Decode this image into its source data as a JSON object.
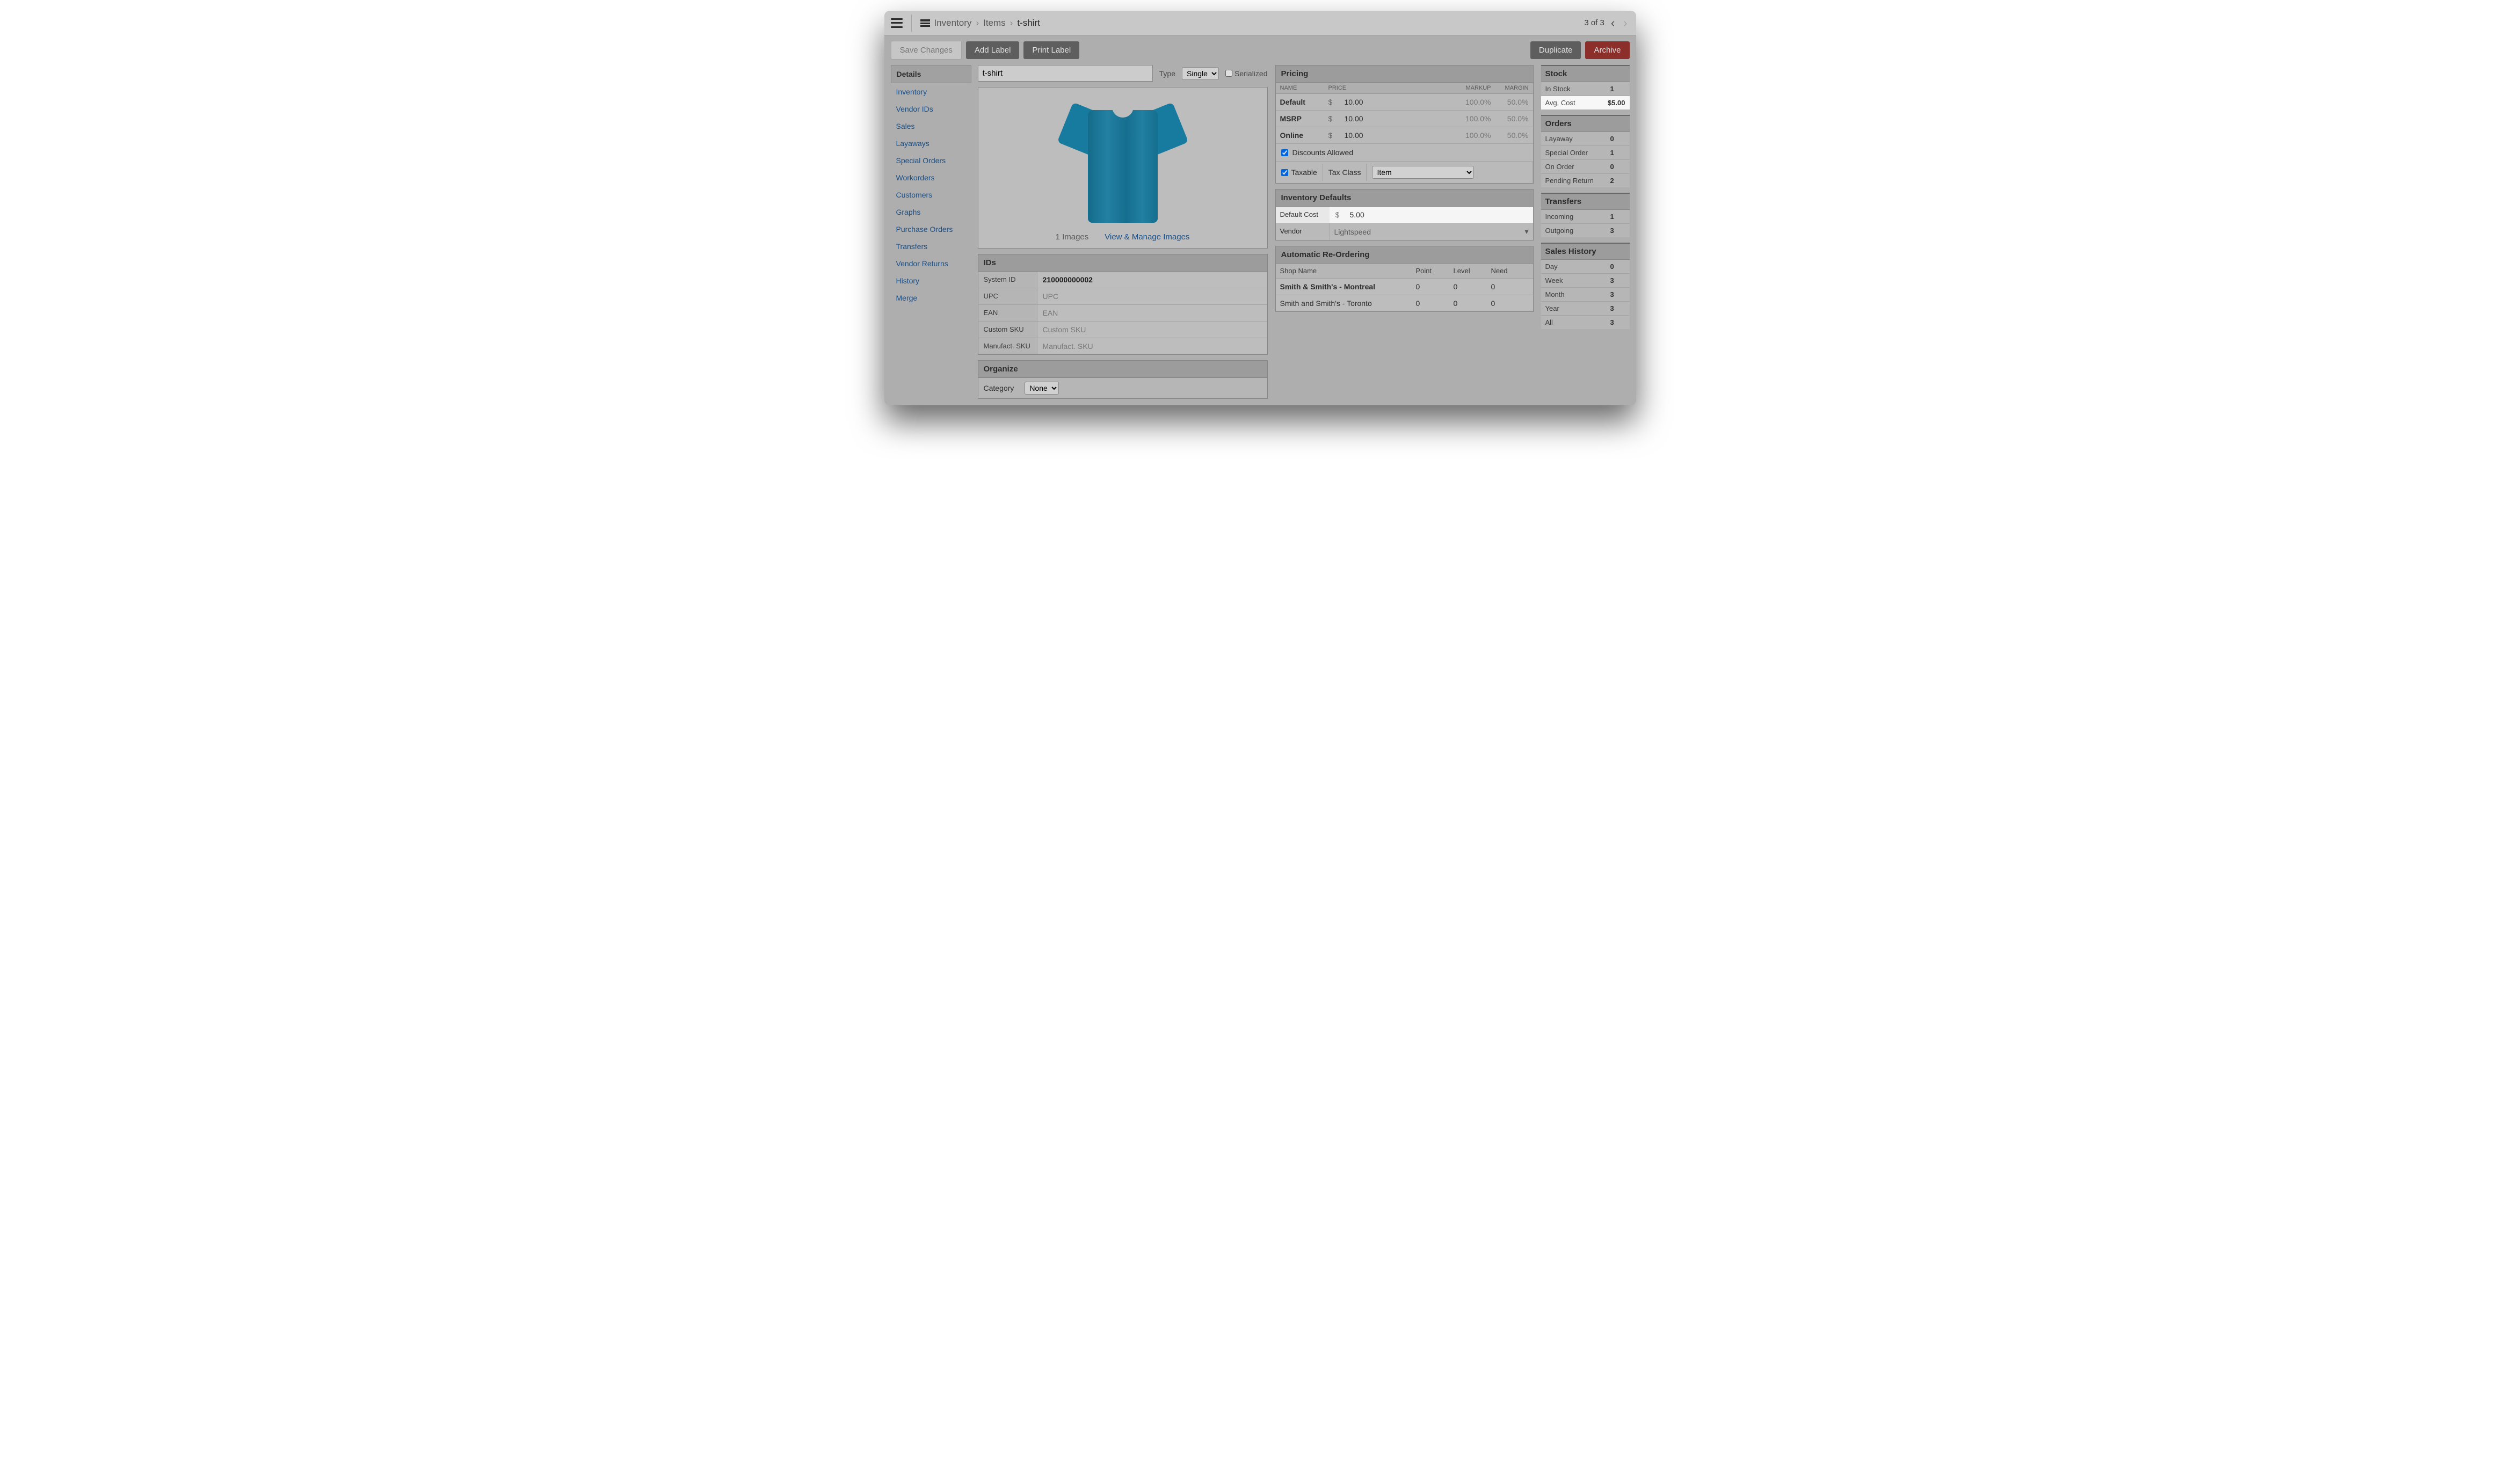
{
  "breadcrumb": {
    "root": "Inventory",
    "mid": "Items",
    "current": "t-shirt"
  },
  "pager": {
    "text": "3 of 3"
  },
  "toolbar": {
    "save": "Save Changes",
    "add_label": "Add Label",
    "print_label": "Print Label",
    "duplicate": "Duplicate",
    "archive": "Archive"
  },
  "sidebar": {
    "items": [
      "Details",
      "Inventory",
      "Vendor IDs",
      "Sales",
      "Layaways",
      "Special Orders",
      "Workorders",
      "Customers",
      "Graphs",
      "Purchase Orders",
      "Transfers",
      "Vendor Returns",
      "History",
      "Merge"
    ]
  },
  "item": {
    "name": "t-shirt",
    "type_label": "Type",
    "type_value": "Single",
    "serialized_label": "Serialized"
  },
  "images": {
    "count": "1 Images",
    "manage": "View & Manage Images"
  },
  "ids": {
    "title": "IDs",
    "rows": [
      {
        "label": "System ID",
        "value": "210000000002",
        "bold": true
      },
      {
        "label": "UPC",
        "value": "UPC",
        "ph": true
      },
      {
        "label": "EAN",
        "value": "EAN",
        "ph": true
      },
      {
        "label": "Custom SKU",
        "value": "Custom SKU",
        "ph": true
      },
      {
        "label": "Manufact. SKU",
        "value": "Manufact. SKU",
        "ph": true
      }
    ]
  },
  "organize": {
    "title": "Organize",
    "category_label": "Category",
    "category_value": "None"
  },
  "pricing": {
    "title": "Pricing",
    "cols": {
      "name": "NAME",
      "price": "PRICE",
      "markup": "MARKUP",
      "margin": "MARGIN"
    },
    "rows": [
      {
        "name": "Default",
        "cur": "$",
        "price": "10.00",
        "markup": "100.0%",
        "margin": "50.0%"
      },
      {
        "name": "MSRP",
        "cur": "$",
        "price": "10.00",
        "markup": "100.0%",
        "margin": "50.0%"
      },
      {
        "name": "Online",
        "cur": "$",
        "price": "10.00",
        "markup": "100.0%",
        "margin": "50.0%"
      }
    ],
    "discounts": "Discounts Allowed",
    "taxable": "Taxable",
    "taxclass_label": "Tax Class",
    "taxclass_value": "Item"
  },
  "inv_defaults": {
    "title": "Inventory Defaults",
    "cost_label": "Default Cost",
    "cost_cur": "$",
    "cost_val": "5.00",
    "vendor_label": "Vendor",
    "vendor_val": "Lightspeed"
  },
  "reorder": {
    "title": "Automatic Re-Ordering",
    "cols": {
      "shop": "Shop Name",
      "point": "Point",
      "level": "Level",
      "need": "Need"
    },
    "rows": [
      {
        "shop": "Smith & Smith's - Montreal",
        "point": "0",
        "level": "0",
        "need": "0",
        "bold": true
      },
      {
        "shop": "Smith and Smith's - Toronto",
        "point": "0",
        "level": "0",
        "need": "0",
        "bold": false
      }
    ]
  },
  "stock": {
    "title": "Stock",
    "rows": [
      {
        "label": "In Stock",
        "value": "1"
      },
      {
        "label": "Avg. Cost",
        "value": "$5.00",
        "highlight": true
      }
    ]
  },
  "orders": {
    "title": "Orders",
    "rows": [
      {
        "label": "Layaway",
        "value": "0"
      },
      {
        "label": "Special Order",
        "value": "1"
      },
      {
        "label": "On Order",
        "value": "0"
      },
      {
        "label": "Pending Return",
        "value": "2"
      }
    ]
  },
  "transfers": {
    "title": "Transfers",
    "rows": [
      {
        "label": "Incoming",
        "value": "1"
      },
      {
        "label": "Outgoing",
        "value": "3"
      }
    ]
  },
  "saleshistory": {
    "title": "Sales History",
    "rows": [
      {
        "label": "Day",
        "value": "0"
      },
      {
        "label": "Week",
        "value": "3"
      },
      {
        "label": "Month",
        "value": "3"
      },
      {
        "label": "Year",
        "value": "3"
      },
      {
        "label": "All",
        "value": "3"
      }
    ]
  }
}
